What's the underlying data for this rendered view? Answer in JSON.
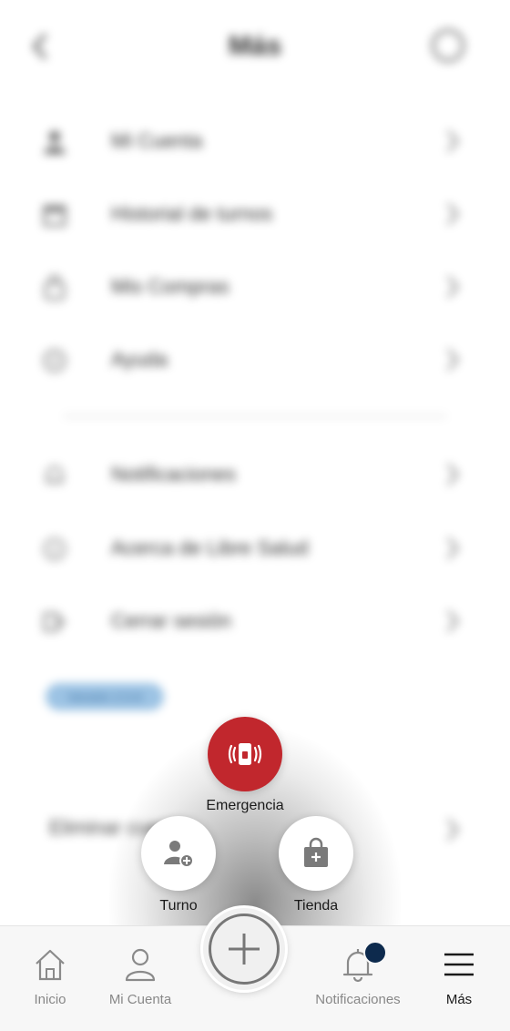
{
  "header": {
    "title": "Más"
  },
  "menu": [
    {
      "label": "Mi Cuenta",
      "icon": "user-icon"
    },
    {
      "label": "Historial de turnos",
      "icon": "calendar-icon"
    },
    {
      "label": "Mis Compras",
      "icon": "bag-icon"
    },
    {
      "label": "Ayuda",
      "icon": "help-icon"
    },
    {
      "label": "Notificaciones",
      "icon": "bell-icon"
    },
    {
      "label": "Acerca de Libre Salud",
      "icon": "info-icon"
    },
    {
      "label": "Cerrar sesión",
      "icon": "logout-icon"
    }
  ],
  "version_badge": "Versión 2.0.6",
  "delete_account": "Eliminar cuenta",
  "fab_actions": {
    "emergency": "Emergencia",
    "turno": "Turno",
    "tienda": "Tienda"
  },
  "bottom_nav": {
    "inicio": "Inicio",
    "mi_cuenta": "Mi Cuenta",
    "notificaciones": "Notificaciones",
    "mas": "Más"
  },
  "colors": {
    "emergency": "#c1272d",
    "notification_dot": "#0d2a4d",
    "icon_gray": "#7a7a7a"
  }
}
